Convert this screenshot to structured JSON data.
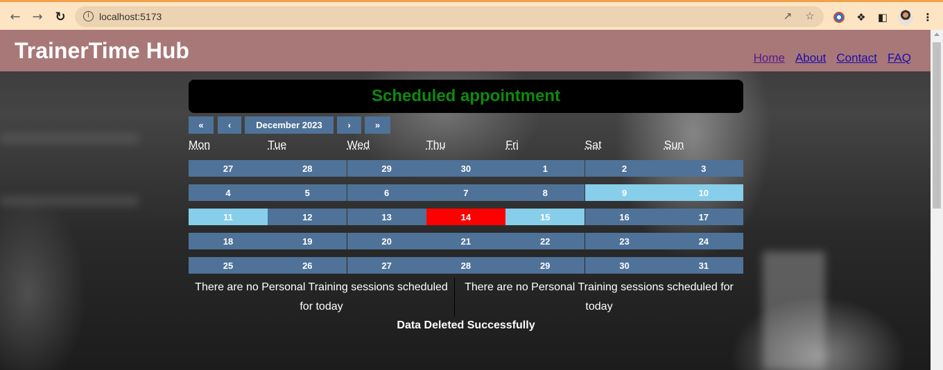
{
  "browser": {
    "url": "localhost:5173",
    "icons": [
      "back-arrow-icon",
      "forward-arrow-icon",
      "reload-icon",
      "info-icon",
      "share-icon",
      "star-icon",
      "extension-icon",
      "puzzle-icon",
      "sidepanel-icon",
      "profile-avatar",
      "more-vert-icon"
    ]
  },
  "header": {
    "brand": "TrainerTime Hub",
    "nav": [
      "Home",
      "About",
      "Contact",
      "FAQ"
    ]
  },
  "banner": {
    "title": "Scheduled appointment"
  },
  "calendar": {
    "nav": {
      "prev2": "«",
      "prev": "‹",
      "label": "December 2023",
      "next": "›",
      "next2": "»"
    },
    "weekdays": [
      "Mon",
      "Tue",
      "Wed",
      "Thu",
      "Fri",
      "Sat",
      "Sun"
    ],
    "weeks": [
      [
        "27",
        "28",
        "29",
        "30",
        "1",
        "2",
        "3"
      ],
      [
        "4",
        "5",
        "6",
        "7",
        "8",
        "9",
        "10"
      ],
      [
        "11",
        "12",
        "13",
        "14",
        "15",
        "16",
        "17"
      ],
      [
        "18",
        "19",
        "20",
        "21",
        "22",
        "23",
        "24"
      ],
      [
        "25",
        "26",
        "27",
        "28",
        "29",
        "30",
        "31"
      ]
    ],
    "highlighted_days": [
      "9",
      "10",
      "11",
      "15"
    ],
    "today": "14",
    "colors": {
      "tile": "#4f7298",
      "highlight": "#87ceeb",
      "today": "#ff0000"
    }
  },
  "messages": {
    "left": "There are no Personal Training sessions scheduled for today",
    "right": "There are no Personal Training sessions scheduled for today",
    "status": "Data Deleted Successfully"
  }
}
